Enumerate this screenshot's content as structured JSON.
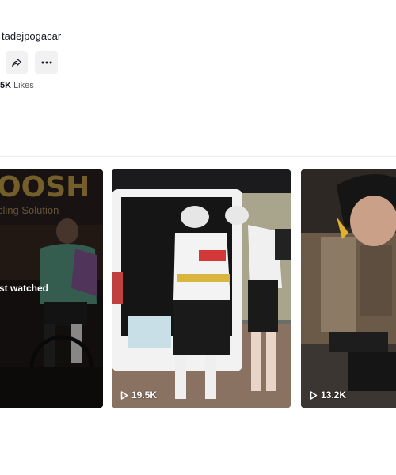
{
  "profile": {
    "username": "tadejpogacar"
  },
  "actions": {
    "share_icon": "share-icon",
    "more_icon": "more-icon"
  },
  "stats": {
    "likes_count": "5K",
    "likes_label": "Likes"
  },
  "videos": [
    {
      "overlay_label": "st watched",
      "brand_text": "OOSH",
      "brand_sub": "cling Solution",
      "views": ""
    },
    {
      "overlay_label": "",
      "brand_text": "",
      "brand_sub": "",
      "views": "19.5K"
    },
    {
      "overlay_label": "",
      "brand_text": "",
      "brand_sub": "",
      "views": "13.2K"
    }
  ]
}
